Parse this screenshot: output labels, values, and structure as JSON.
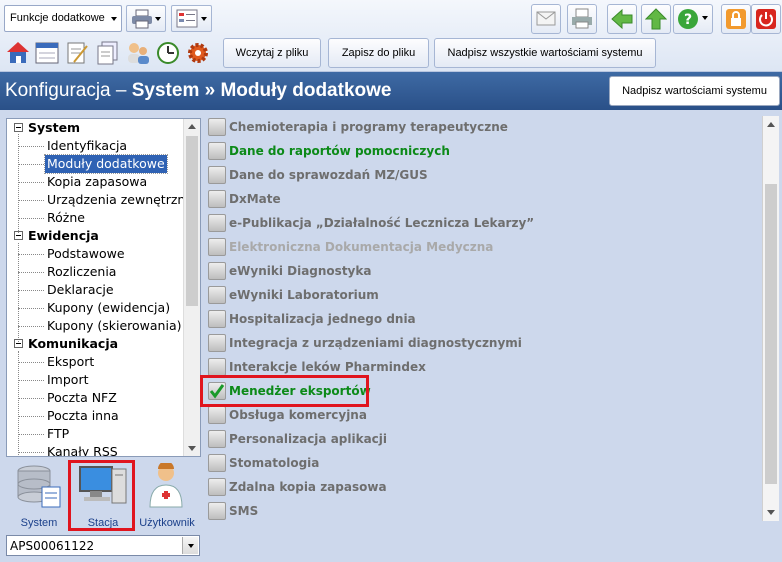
{
  "toolbar": {
    "functions_dropdown": "Funkcje dodatkowe",
    "load_from_file": "Wczytaj z pliku",
    "save_to_file": "Zapisz do pliku",
    "overwrite_all_system": "Nadpisz wszystkie wartościami systemu"
  },
  "header": {
    "title_prefix": "Konfiguracja – ",
    "title_bold": "System » Moduły dodatkowe",
    "overwrite_system": "Nadpisz wartościami systemu"
  },
  "tree": {
    "groups": [
      {
        "label": "System",
        "items": [
          "Identyfikacja",
          "Moduły dodatkowe",
          "Kopia zapasowa",
          "Urządzenia zewnętrzne",
          "Różne"
        ]
      },
      {
        "label": "Ewidencja",
        "items": [
          "Podstawowe",
          "Rozliczenia",
          "Deklaracje",
          "Kupony (ewidencja)",
          "Kupony (skierowania)"
        ]
      },
      {
        "label": "Komunikacja",
        "items": [
          "Eksport",
          "Import",
          "Poczta NFZ",
          "Poczta inna",
          "FTP",
          "Kanały RSS"
        ]
      }
    ],
    "selected": "Moduły dodatkowe"
  },
  "scope": {
    "system": "System",
    "station": "Stacja",
    "user": "Użytkownik",
    "selected": "Stacja"
  },
  "station_select": "APS00061122",
  "modules": [
    {
      "name": "Chemioterapia i programy terapeutyczne",
      "checked": false,
      "style": "normal"
    },
    {
      "name": "Dane do raportów pomocniczych",
      "checked": false,
      "style": "green"
    },
    {
      "name": "Dane do sprawozdań MZ/GUS",
      "checked": false,
      "style": "normal"
    },
    {
      "name": "DxMate",
      "checked": false,
      "style": "normal"
    },
    {
      "name": "e-Publikacja „Działalność Lecznicza Lekarzy”",
      "checked": false,
      "style": "normal"
    },
    {
      "name": "Elektroniczna Dokumentacja Medyczna",
      "checked": false,
      "style": "disabled"
    },
    {
      "name": "eWyniki Diagnostyka",
      "checked": false,
      "style": "normal"
    },
    {
      "name": "eWyniki Laboratorium",
      "checked": false,
      "style": "normal"
    },
    {
      "name": "Hospitalizacja jednego dnia",
      "checked": false,
      "style": "normal"
    },
    {
      "name": "Integracja z urządzeniami diagnostycznymi",
      "checked": false,
      "style": "normal"
    },
    {
      "name": "Interakcje leków Pharmindex",
      "checked": false,
      "style": "normal"
    },
    {
      "name": "Menedżer eksportów",
      "checked": true,
      "style": "green"
    },
    {
      "name": "Obsługa komercyjna",
      "checked": false,
      "style": "normal"
    },
    {
      "name": "Personalizacja aplikacji",
      "checked": false,
      "style": "normal"
    },
    {
      "name": "Stomatologia",
      "checked": false,
      "style": "normal"
    },
    {
      "name": "Zdalna kopia zapasowa",
      "checked": false,
      "style": "normal"
    },
    {
      "name": "SMS",
      "checked": false,
      "style": "normal"
    }
  ],
  "icons": {
    "top_right": [
      "mail-icon",
      "print-preview-icon",
      "back-arrow-icon",
      "up-arrow-icon",
      "help-icon",
      "lock-icon",
      "power-icon"
    ],
    "small_row": [
      "home-icon",
      "calendar-icon",
      "document-edit-icon",
      "documents-icon",
      "patients-icon",
      "clock-icon",
      "gear-icon"
    ]
  },
  "colors": {
    "header_blue": "#2f5a93",
    "selected_blue": "#2f62b4",
    "module_green": "#0c8a18",
    "highlight_red": "#e0141e"
  }
}
